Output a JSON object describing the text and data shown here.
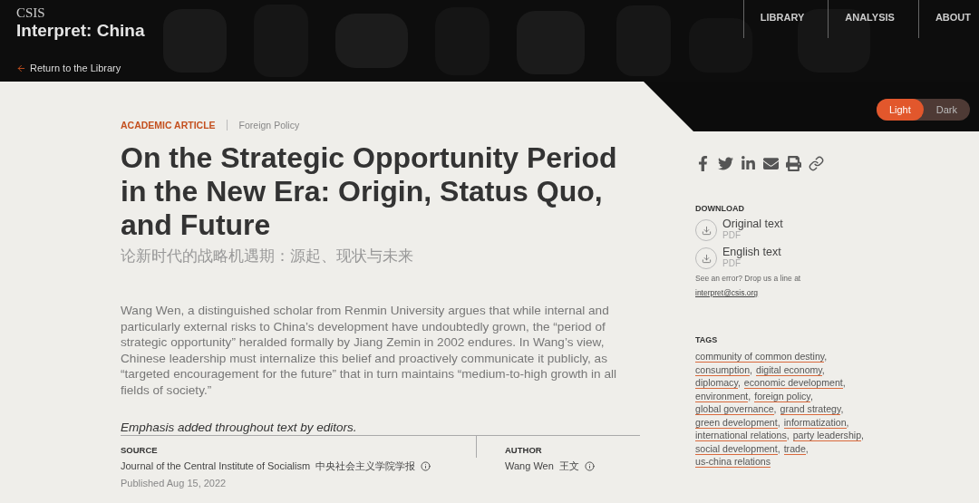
{
  "header": {
    "logo_small": "CSIS",
    "logo_title": "Interpret: China",
    "back_link": "Return to the Library",
    "nav": [
      {
        "label": "LIBRARY"
      },
      {
        "label": "ANALYSIS"
      },
      {
        "label": "ABOUT"
      }
    ]
  },
  "theme_toggle": [
    {
      "label": "Light",
      "selected": true
    },
    {
      "label": "Dark",
      "selected": false
    }
  ],
  "article": {
    "category": "ACADEMIC ARTICLE",
    "topic": "Foreign Policy",
    "title": "On the Strategic Opportunity Period in the New Era: Origin, Status Quo, and Future",
    "title_zh": "论新时代的战略机遇期：源起、现状与未来",
    "summary": "Wang Wen, a distinguished scholar from Renmin University argues that while internal and particularly external risks to China’s development have undoubtedly grown, the “period of strategic opportunity” heralded formally by Jiang Zemin in 2002 endures. In Wang’s view, Chinese leadership must internalize this belief and proactively communicate it publicly, as “targeted encouragement for the future” that in turn maintains “medium-to-high growth in all fields of society.”",
    "note": "Emphasis added throughout text by editors.",
    "source": {
      "heading": "SOURCE",
      "name": "Journal of the Central Institute of Socialism",
      "name_zh": "中央社会主义学院学报",
      "published": "Published Aug 15, 2022"
    },
    "author": {
      "heading": "AUTHOR",
      "name": "Wang Wen",
      "name_zh": "王文"
    }
  },
  "sidebar": {
    "share": [
      {
        "kind": "facebook"
      },
      {
        "kind": "twitter"
      },
      {
        "kind": "linkedin"
      },
      {
        "kind": "email"
      },
      {
        "kind": "print"
      },
      {
        "kind": "link"
      }
    ],
    "download": {
      "heading": "DOWNLOAD",
      "files": [
        {
          "label": "Original text",
          "format": "PDF"
        },
        {
          "label": "English text",
          "format": "PDF"
        }
      ]
    },
    "error_note": "See an error? Drop us a line at",
    "error_email": "interpret@csis.org",
    "tags": {
      "heading": "TAGS",
      "separator": ",",
      "items": [
        "community of common destiny",
        "consumption",
        "digital economy",
        "diplomacy",
        "economic development",
        "environment",
        "foreign policy",
        "global governance",
        "grand strategy",
        "green development",
        "informatization",
        "international relations",
        "party leadership",
        "social development",
        "trade",
        "us-china relations"
      ]
    }
  }
}
